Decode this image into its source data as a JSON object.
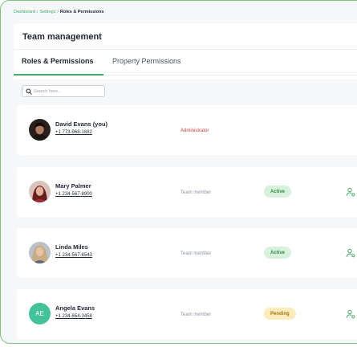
{
  "breadcrumb": {
    "dashboard": "Dashboard",
    "settings": "Settings",
    "current": "Roles & Permissions",
    "separator": "/"
  },
  "page": {
    "title": "Team management"
  },
  "tabs": [
    {
      "label": "Roles & Permissions",
      "active": true
    },
    {
      "label": "Property Permissions",
      "active": false
    }
  ],
  "search": {
    "placeholder": "Search here..."
  },
  "members": [
    {
      "name": "David Evans (you)",
      "phone": "+1 773-968-1682",
      "role": "Administrator",
      "status": "",
      "initials": ""
    },
    {
      "name": "Mary Palmer",
      "phone": "+1 234-567-8900",
      "role": "Team member",
      "status": "Active",
      "initials": ""
    },
    {
      "name": "Linda Miles",
      "phone": "+1 234-567-6543",
      "role": "Team member",
      "status": "Active",
      "initials": ""
    },
    {
      "name": "Angela Evans",
      "phone": "+1 234-654-3458",
      "role": "Team member",
      "status": "Pending",
      "initials": "AE"
    }
  ],
  "icons": {
    "search": "search-icon",
    "manage": "user-settings-icon"
  },
  "colors": {
    "accent": "#46a86a",
    "admin_role": "#c1443c",
    "active_badge_bg": "#d8f1dd",
    "pending_badge_bg": "#fcecbc",
    "avatar_initials_bg": "#43c29a"
  }
}
